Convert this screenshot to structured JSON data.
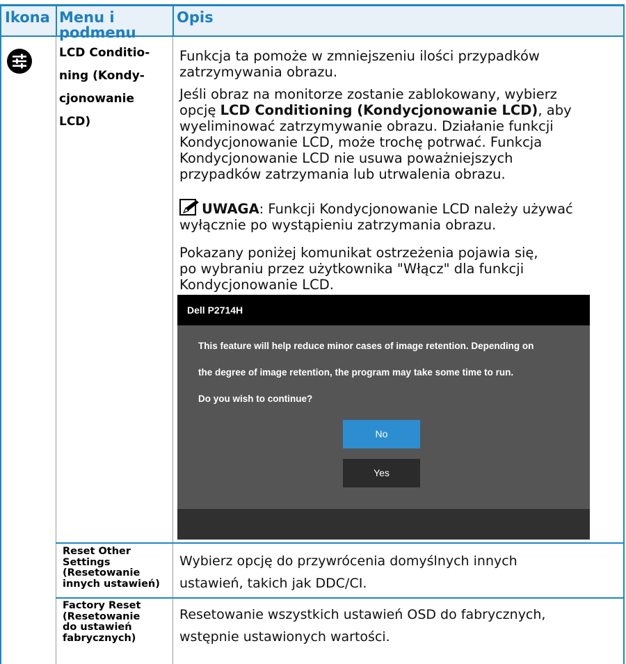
{
  "header": {
    "col_icon": "Ikona",
    "col_menu_1": "Menu i",
    "col_menu_2": "podmenu",
    "col_desc": "Opis"
  },
  "rows": [
    {
      "menu_lines": [
        "LCD Conditio-",
        "ning (Kondy-",
        "cjonowanie",
        "LCD)"
      ],
      "icon": "settings-sliders-icon",
      "desc_p1": [
        "Funkcja ta pomoże w zmniejszeniu ilości przypadków",
        "zatrzymywania obrazu."
      ],
      "desc_p2_l1": "Jeśli obraz na monitorze zostanie zablokowany, wybierz",
      "desc_p2_l2_pre": "opcję ",
      "desc_p2_l2_bold": "LCD Conditioning (Kondycjonowanie LCD)",
      "desc_p2_l2_post": ", aby",
      "desc_p2_rest": [
        "wyeliminować zatrzymywanie obrazu. Działanie funkcji",
        "Kondycjonowanie LCD, może trochę potrwać. Funkcja",
        "Kondycjonowanie LCD nie usuwa poważniejszych",
        "przypadków zatrzymania lub utrwalenia obrazu."
      ],
      "note_label": "UWAGA",
      "note_text": ": Funkcji Kondycjonowanie LCD należy używać",
      "note_text_2": "wyłącznie po wystąpieniu zatrzymania obrazu.",
      "desc_p3": [
        "Pokazany poniżej komunikat ostrzeżenia pojawia się,",
        "po wybraniu przez użytkownika \"Włącz\" dla funkcji",
        "Kondycjonowanie LCD."
      ]
    },
    {
      "menu_lines": [
        "Reset Other",
        "Settings",
        "(Resetowanie",
        "innych ustawień)"
      ],
      "desc": [
        "Wybierz opcję do przywrócenia domyślnych innych",
        "ustawień, takich jak DDC/CI."
      ]
    },
    {
      "menu_lines": [
        "Factory Reset",
        "(Resetowanie",
        "do ustawień",
        "fabrycznych)"
      ],
      "desc": [
        "Resetowanie wszystkich ustawień OSD do fabrycznych,",
        "wstępnie ustawionych wartości."
      ]
    }
  ],
  "dialog": {
    "title": "Dell P2714H",
    "lines": [
      "This feature will help reduce minor cases of image retention. Depending on",
      "the degree of image retention, the program may take some time to run.",
      "Do you wish to continue?"
    ],
    "no_label": "No",
    "yes_label": "Yes",
    "colors": {
      "no_button": "#2d8dd1",
      "yes_button": "#2b2b2b",
      "body": "#555555",
      "title_bar": "#000000"
    }
  },
  "colors": {
    "accent": "#1d86c4",
    "header_text": "#1c7fc0"
  }
}
